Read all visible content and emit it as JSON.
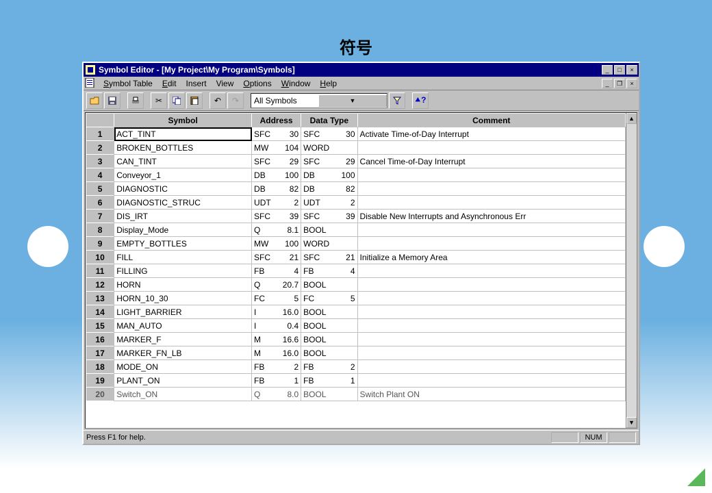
{
  "page_heading": "符号",
  "window": {
    "title": "Symbol Editor - [My Project\\My Program\\Symbols]"
  },
  "menu": {
    "symbol_table": "Symbol Table",
    "edit": "Edit",
    "insert": "Insert",
    "view": "View",
    "options": "Options",
    "window": "Window",
    "help": "Help"
  },
  "toolbar": {
    "filter": "All Symbols"
  },
  "columns": {
    "symbol": "Symbol",
    "address": "Address",
    "data_type": "Data Type",
    "comment": "Comment"
  },
  "rows": [
    {
      "n": "1",
      "sym": "ACT_TINT",
      "addr_t": "SFC",
      "addr_n": "30",
      "dt_t": "SFC",
      "dt_n": "30",
      "com": "Activate Time-of-Day Interrupt"
    },
    {
      "n": "2",
      "sym": "BROKEN_BOTTLES",
      "addr_t": "MW",
      "addr_n": "104",
      "dt_t": "WORD",
      "dt_n": "",
      "com": ""
    },
    {
      "n": "3",
      "sym": "CAN_TINT",
      "addr_t": "SFC",
      "addr_n": "29",
      "dt_t": "SFC",
      "dt_n": "29",
      "com": "Cancel Time-of-Day Interrupt"
    },
    {
      "n": "4",
      "sym": "Conveyor_1",
      "addr_t": "DB",
      "addr_n": "100",
      "dt_t": "DB",
      "dt_n": "100",
      "com": ""
    },
    {
      "n": "5",
      "sym": "DIAGNOSTIC",
      "addr_t": "DB",
      "addr_n": "82",
      "dt_t": "DB",
      "dt_n": "82",
      "com": ""
    },
    {
      "n": "6",
      "sym": "DIAGNOSTIC_STRUC",
      "addr_t": "UDT",
      "addr_n": "2",
      "dt_t": "UDT",
      "dt_n": "2",
      "com": ""
    },
    {
      "n": "7",
      "sym": "DIS_IRT",
      "addr_t": "SFC",
      "addr_n": "39",
      "dt_t": "SFC",
      "dt_n": "39",
      "com": "Disable New Interrupts and Asynchronous Err"
    },
    {
      "n": "8",
      "sym": "Display_Mode",
      "addr_t": "Q",
      "addr_n": "8.1",
      "dt_t": "BOOL",
      "dt_n": "",
      "com": ""
    },
    {
      "n": "9",
      "sym": "EMPTY_BOTTLES",
      "addr_t": "MW",
      "addr_n": "100",
      "dt_t": "WORD",
      "dt_n": "",
      "com": ""
    },
    {
      "n": "10",
      "sym": "FILL",
      "addr_t": "SFC",
      "addr_n": "21",
      "dt_t": "SFC",
      "dt_n": "21",
      "com": "Initialize a Memory Area"
    },
    {
      "n": "11",
      "sym": "FILLING",
      "addr_t": "FB",
      "addr_n": "4",
      "dt_t": "FB",
      "dt_n": "4",
      "com": ""
    },
    {
      "n": "12",
      "sym": "HORN",
      "addr_t": "Q",
      "addr_n": "20.7",
      "dt_t": "BOOL",
      "dt_n": "",
      "com": ""
    },
    {
      "n": "13",
      "sym": "HORN_10_30",
      "addr_t": "FC",
      "addr_n": "5",
      "dt_t": "FC",
      "dt_n": "5",
      "com": ""
    },
    {
      "n": "14",
      "sym": "LIGHT_BARRIER",
      "addr_t": "I",
      "addr_n": "16.0",
      "dt_t": "BOOL",
      "dt_n": "",
      "com": ""
    },
    {
      "n": "15",
      "sym": "MAN_AUTO",
      "addr_t": "I",
      "addr_n": "0.4",
      "dt_t": "BOOL",
      "dt_n": "",
      "com": ""
    },
    {
      "n": "16",
      "sym": "MARKER_F",
      "addr_t": "M",
      "addr_n": "16.6",
      "dt_t": "BOOL",
      "dt_n": "",
      "com": ""
    },
    {
      "n": "17",
      "sym": "MARKER_FN_LB",
      "addr_t": "M",
      "addr_n": "16.0",
      "dt_t": "BOOL",
      "dt_n": "",
      "com": ""
    },
    {
      "n": "18",
      "sym": "MODE_ON",
      "addr_t": "FB",
      "addr_n": "2",
      "dt_t": "FB",
      "dt_n": "2",
      "com": ""
    },
    {
      "n": "19",
      "sym": "PLANT_ON",
      "addr_t": "FB",
      "addr_n": "1",
      "dt_t": "FB",
      "dt_n": "1",
      "com": ""
    },
    {
      "n": "20",
      "sym": "Switch_ON",
      "addr_t": "Q",
      "addr_n": "8.0",
      "dt_t": "BOOL",
      "dt_n": "",
      "com": "Switch Plant ON"
    }
  ],
  "status": {
    "help": "Press F1 for help.",
    "num": "NUM"
  }
}
